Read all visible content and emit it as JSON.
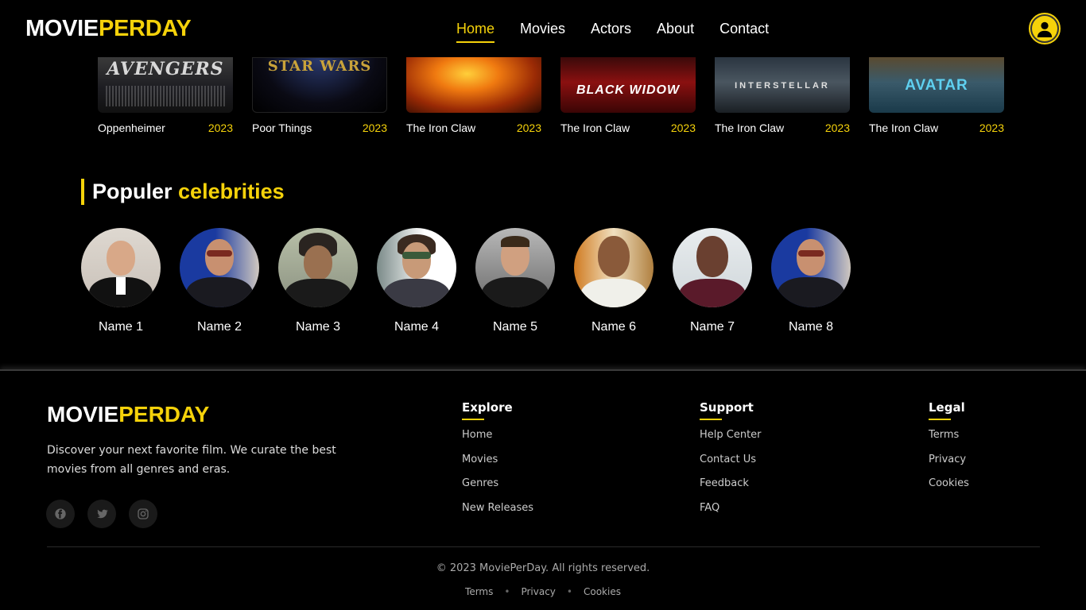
{
  "header": {
    "logo_part1": "MOVIE",
    "logo_part2": "PERDAY",
    "nav": [
      "Home",
      "Movies",
      "Actors",
      "About",
      "Contact"
    ],
    "active_nav": "Home",
    "profile_icon": "user-icon"
  },
  "movies": [
    {
      "poster_text": "AVENGERS",
      "title": "Oppenheimer",
      "year": "2023"
    },
    {
      "poster_text": "STAR WARS",
      "title": "Poor Things",
      "year": "2023"
    },
    {
      "poster_text": "",
      "title": "The Iron Claw",
      "year": "2023"
    },
    {
      "poster_text": "BLACK WIDOW",
      "title": "The Iron Claw",
      "year": "2023"
    },
    {
      "poster_text": "INTERSTELLAR",
      "title": "The Iron Claw",
      "year": "2023"
    },
    {
      "poster_text": "AVATAR",
      "title": "The Iron Claw",
      "year": "2023"
    }
  ],
  "celebrities": {
    "title_part1": "Populer",
    "title_part2": "celebrities",
    "items": [
      "Name 1",
      "Name 2",
      "Name 3",
      "Name 4",
      "Name 5",
      "Name 6",
      "Name 7",
      "Name 8"
    ]
  },
  "footer": {
    "logo_part1": "MOVIE",
    "logo_part2": "PERDAY",
    "description": "Discover your next favorite film. We curate the best movies from all genres and eras.",
    "socials": [
      "facebook-icon",
      "twitter-icon",
      "instagram-icon"
    ],
    "columns": [
      {
        "title": "Explore",
        "links": [
          "Home",
          "Movies",
          "Genres",
          "New Releases"
        ]
      },
      {
        "title": "Support",
        "links": [
          "Help Center",
          "Contact Us",
          "Feedback",
          "FAQ"
        ]
      },
      {
        "title": "Legal",
        "links": [
          "Terms",
          "Privacy",
          "Cookies"
        ]
      }
    ],
    "copyright": "© 2023 MoviePerDay. All rights reserved.",
    "bottom_links": [
      "Terms",
      "Privacy",
      "Cookies"
    ]
  },
  "colors": {
    "accent": "#f5d20a",
    "background": "#000000"
  }
}
